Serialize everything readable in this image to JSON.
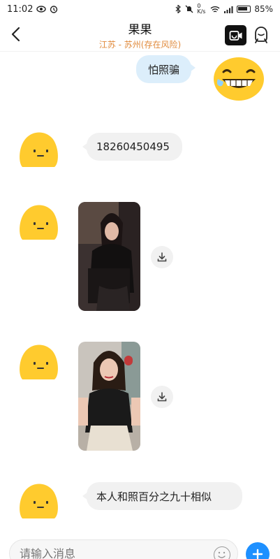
{
  "status_bar": {
    "time": "11:02",
    "network_speed": "0 K/s",
    "battery": "85%"
  },
  "header": {
    "back_icon": "chevron-left-icon",
    "title": "果果",
    "subtitle": "江苏 - 苏州(存在风险)",
    "video_call_icon": "video-call-icon",
    "profile_icon": "profile-icon"
  },
  "messages": [
    {
      "direction": "outgoing",
      "type": "text",
      "text": "怕照骗",
      "emoji": "grinning-sweat-emoji"
    },
    {
      "direction": "incoming",
      "type": "text",
      "text": "18260450495"
    },
    {
      "direction": "incoming",
      "type": "image",
      "description": "photo-1",
      "download_icon": "download-icon"
    },
    {
      "direction": "incoming",
      "type": "image",
      "description": "photo-2",
      "download_icon": "download-icon"
    },
    {
      "direction": "incoming",
      "type": "text",
      "text": "本人和照百分之九十相似"
    }
  ],
  "input_bar": {
    "placeholder": "请输入消息",
    "emoji_icon": "emoji-icon",
    "plus_icon": "plus-icon"
  },
  "colors": {
    "subtitle": "#e08a3c",
    "incoming_bubble": "#f1f1f1",
    "outgoing_bubble": "#dceefb",
    "avatar_yellow": "#ffcb2e",
    "plus_button": "#1e90ff"
  }
}
